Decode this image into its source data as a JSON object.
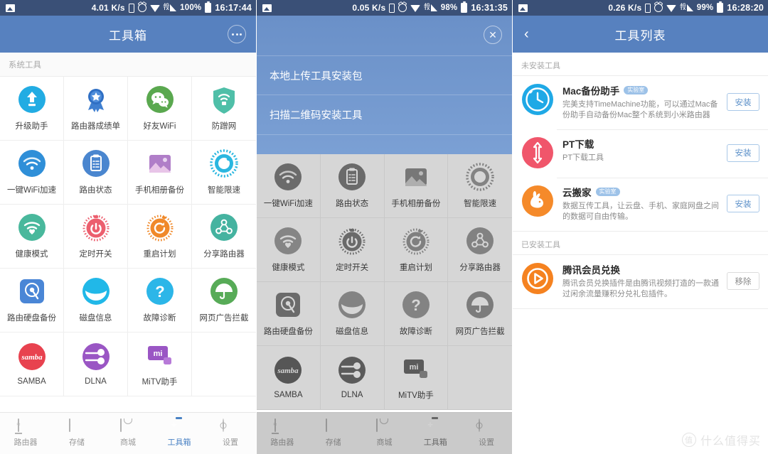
{
  "panels": [
    {
      "statusbar": {
        "speed": "4.01 K/s",
        "battery": "100%",
        "time": "16:17:44",
        "photo_icon": "image-icon",
        "sim_icon": "sim-card-icon",
        "alarm_icon": "alarm-clock-icon",
        "wifi_icon": "wifi-icon",
        "signal_icon": "signal-4g-icon",
        "battery_icon": "battery-icon"
      },
      "appbar": {
        "title": "工具箱",
        "right_icon": "more-options-icon"
      },
      "section_label": "系统工具",
      "tools": [
        {
          "label": "升级助手",
          "icon": "upgrade-assistant-icon"
        },
        {
          "label": "路由器成绩单",
          "icon": "router-report-icon"
        },
        {
          "label": "好友WiFi",
          "icon": "friend-wifi-icon"
        },
        {
          "label": "防蹭网",
          "icon": "anti-leech-shield-icon"
        },
        {
          "label": "一键WiFi加速",
          "icon": "wifi-boost-icon"
        },
        {
          "label": "路由状态",
          "icon": "router-status-icon"
        },
        {
          "label": "手机相册备份",
          "icon": "photo-backup-icon"
        },
        {
          "label": "智能限速",
          "icon": "smart-speed-limit-icon"
        },
        {
          "label": "健康模式",
          "icon": "health-mode-icon"
        },
        {
          "label": "定时开关",
          "icon": "timer-switch-icon"
        },
        {
          "label": "重启计划",
          "icon": "reboot-plan-icon"
        },
        {
          "label": "分享路由器",
          "icon": "share-router-icon"
        },
        {
          "label": "路由硬盘备份",
          "icon": "disk-backup-icon"
        },
        {
          "label": "磁盘信息",
          "icon": "disk-info-icon"
        },
        {
          "label": "故障诊断",
          "icon": "diagnostics-icon"
        },
        {
          "label": "网页广告拦截",
          "icon": "ad-block-icon"
        },
        {
          "label": "SAMBA",
          "icon": "samba-icon"
        },
        {
          "label": "DLNA",
          "icon": "dlna-icon"
        },
        {
          "label": "MiTV助手",
          "icon": "mitv-assistant-icon"
        }
      ],
      "nav": [
        {
          "label": "路由器",
          "icon": "router-icon",
          "active": false
        },
        {
          "label": "存储",
          "icon": "storage-icon",
          "active": false
        },
        {
          "label": "商城",
          "icon": "store-icon",
          "active": false
        },
        {
          "label": "工具箱",
          "icon": "toolbox-icon",
          "active": true
        },
        {
          "label": "设置",
          "icon": "gear-icon",
          "active": false
        }
      ]
    },
    {
      "statusbar": {
        "speed": "0.05 K/s",
        "battery": "98%",
        "time": "16:31:35"
      },
      "menu": {
        "close_icon": "close-icon",
        "items": [
          "本地上传工具安装包",
          "扫描二维码安装工具"
        ]
      }
    },
    {
      "statusbar": {
        "speed": "0.26 K/s",
        "battery": "99%",
        "time": "16:28:20"
      },
      "appbar": {
        "title": "工具列表",
        "back_icon": "chevron-left-icon"
      },
      "sections": [
        {
          "label": "未安装工具",
          "rows": [
            {
              "title": "Mac备份助手",
              "badge": "实验室",
              "desc": "完美支持TimeMachine功能，可以通过Mac备份助手自动备份Mac整个系统到小米路由器",
              "action": "安装",
              "action_type": "install",
              "icon": "mac-backup-clock-icon"
            },
            {
              "title": "PT下载",
              "badge": "",
              "desc": "PT下载工具",
              "action": "安装",
              "action_type": "install",
              "icon": "pt-download-arrows-icon"
            },
            {
              "title": "云搬家",
              "badge": "实验室",
              "desc": "数据互传工具，让云盘、手机、家庭网盘之间的数据可自由传输。",
              "action": "安装",
              "action_type": "install",
              "icon": "cloud-move-rabbit-icon"
            }
          ]
        },
        {
          "label": "已安装工具",
          "rows": [
            {
              "title": "腾讯会员兑换",
              "badge": "",
              "desc": "腾讯会员兑换插件是由腾讯视频打造的一款通过闲余流量赚积分兑礼包插件。",
              "action": "移除",
              "action_type": "remove",
              "icon": "tencent-video-play-icon"
            }
          ]
        }
      ],
      "watermark": {
        "mark": "值",
        "text": "什么值得买"
      }
    }
  ],
  "colors": {
    "statusbar": "#3a5077",
    "appbar": "#5781bf",
    "accent": "#4a82c4",
    "menu_overlay": "#6f95cc",
    "badge": "#9dc2e8",
    "install_border": "#a9c8e8",
    "install_text": "#5d91c9"
  }
}
